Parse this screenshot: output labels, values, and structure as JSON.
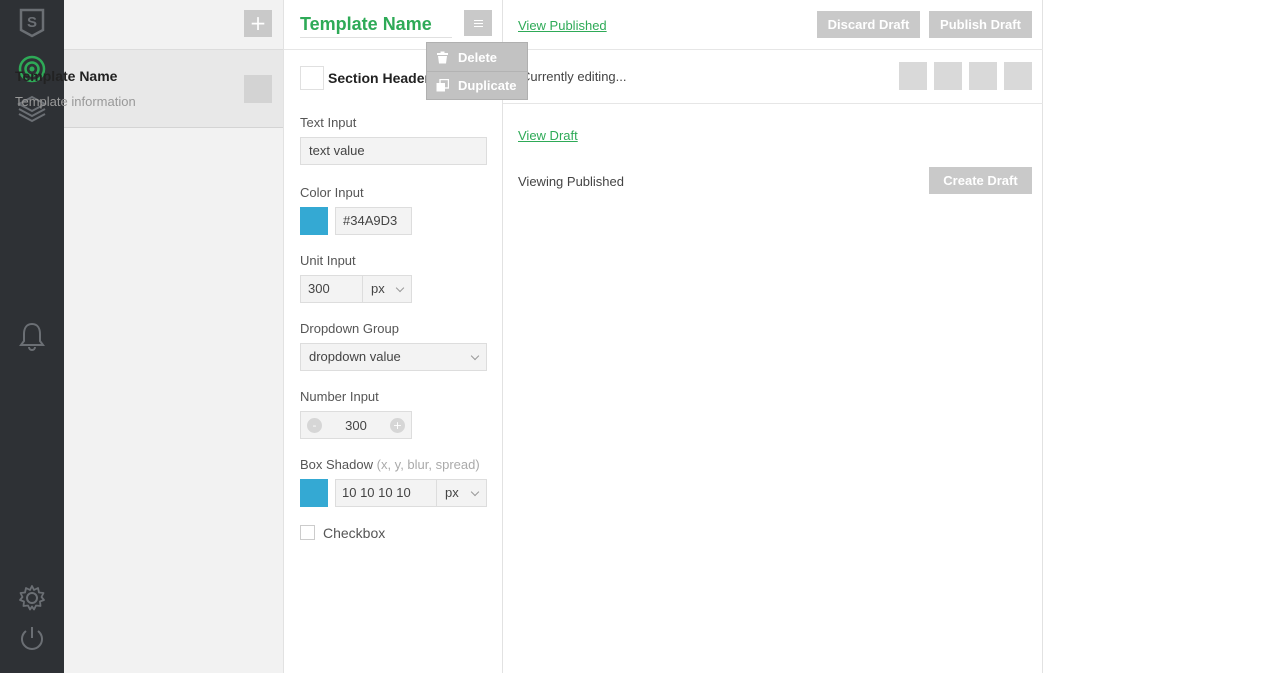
{
  "sidebar_icons": [
    "logo-s-icon",
    "target-icon",
    "layers-icon",
    "bell-icon",
    "gear-icon",
    "power-icon"
  ],
  "templates_panel": {
    "add_label": "+",
    "item": {
      "title": "Template Name",
      "subtitle": "Template information"
    }
  },
  "editor": {
    "title": "Template Name",
    "section_header": "Section Header",
    "fields": {
      "text_label": "Text Input",
      "text_value": "text value",
      "color_label": "Color Input",
      "color_value": "#34A9D3",
      "unit_label": "Unit Input",
      "unit_value": "300",
      "unit_unit": "px",
      "dropdown_label": "Dropdown Group",
      "dropdown_value": "dropdown value",
      "number_label": "Number Input",
      "number_value": "300",
      "number_minus": "-",
      "number_plus": "+",
      "shadow_label": "Box Shadow",
      "shadow_hint": "(x, y, blur, spread)",
      "shadow_value": "10 10 10 10",
      "shadow_unit": "px",
      "checkbox_label": "Checkbox"
    },
    "menu": {
      "delete": "Delete",
      "duplicate": "Duplicate"
    }
  },
  "main": {
    "view_published": "View Published",
    "discard_draft": "Discard Draft",
    "publish_draft": "Publish Draft",
    "currently_editing": "Currently editing...",
    "view_draft": "View Draft",
    "viewing_published": "Viewing Published",
    "create_draft": "Create Draft"
  },
  "colors": {
    "accent": "#2eaa57",
    "swatch": "#34A9D3",
    "rail": "#2e3135"
  }
}
